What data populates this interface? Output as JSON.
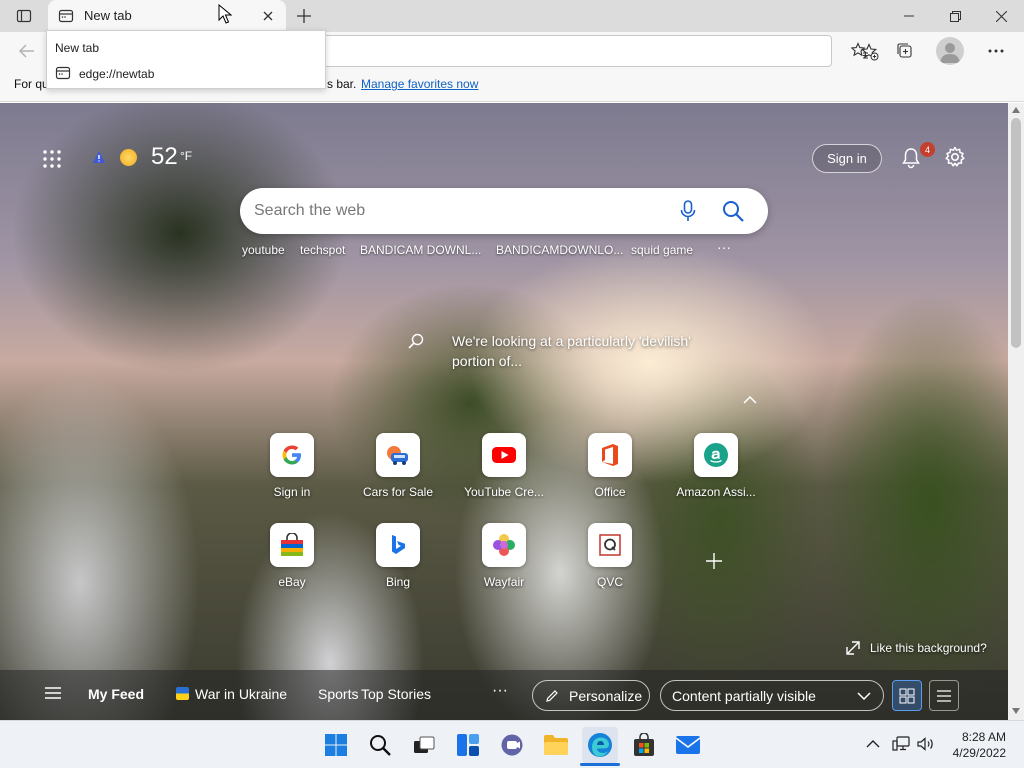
{
  "browser": {
    "tab": {
      "title": "New tab"
    },
    "tooltip": {
      "title": "New tab",
      "url": "edge://newtab"
    },
    "favorites_bar": {
      "text": "For quick access, place your favorites here on the favorites bar.",
      "visible_text": "For qu",
      "visible_text_end": "s bar.",
      "link": "Manage favorites now"
    }
  },
  "page": {
    "weather": {
      "temperature": "52",
      "unit": "°F"
    },
    "sign_in": "Sign in",
    "notifications_count": "4",
    "search": {
      "placeholder": "Search the web"
    },
    "trending": [
      "youtube",
      "techspot",
      "BANDICAM DOWNL...",
      "BANDICAMDOWNLO...",
      "squid game"
    ],
    "trending_more": "···",
    "info_text": "We're looking at a particularly 'devilish' portion of...",
    "quick_links": [
      {
        "label": "Sign in",
        "icon": "google-icon"
      },
      {
        "label": "Cars for Sale",
        "icon": "cars-icon"
      },
      {
        "label": "YouTube Cre...",
        "icon": "youtube-icon"
      },
      {
        "label": "Office",
        "icon": "office-icon"
      },
      {
        "label": "Amazon Assi...",
        "icon": "amazon-icon"
      },
      {
        "label": "eBay",
        "icon": "ebay-icon"
      },
      {
        "label": "Bing",
        "icon": "bing-icon"
      },
      {
        "label": "Wayfair",
        "icon": "wayfair-icon"
      },
      {
        "label": "QVC",
        "icon": "qvc-icon"
      }
    ],
    "like_background": "Like this background?",
    "feed": {
      "items": [
        "My Feed",
        "War in Ukraine",
        "Sports",
        "Top Stories"
      ],
      "more": "···",
      "personalize": "Personalize",
      "content_visibility": "Content partially visible"
    }
  },
  "taskbar": {
    "time": "8:28 AM",
    "date": "4/29/2022"
  },
  "colors": {
    "accent": "#0f62c5",
    "notification_badge": "#c2402e",
    "taskbar_bg": "#eef1f6"
  }
}
